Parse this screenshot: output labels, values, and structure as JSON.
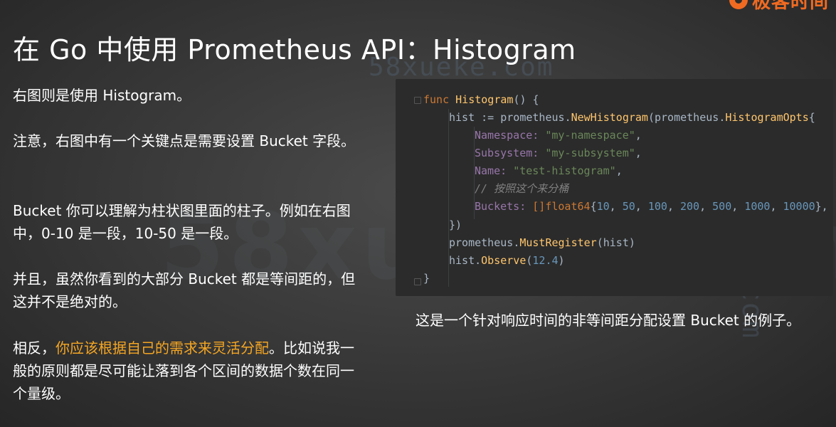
{
  "title": "在 Go 中使用 Prometheus API：Histogram",
  "brand": {
    "logo_text": "极客时间",
    "color": "#f06a21"
  },
  "watermark": {
    "text": "58xueke.com",
    "text_spaced": "58xueke.com"
  },
  "paragraphs": {
    "p1": "右图则是使用 Histogram。",
    "p2": "注意，右图中有一个关键点是需要设置 Bucket 字段。",
    "p3": "Bucket 你可以理解为柱状图里面的柱子。例如在右图中，0-10 是一段，10-50 是一段。",
    "p4": "并且，虽然你看到的大部分 Bucket 都是等间距的，但这并不是绝对的。",
    "p5_pre": "相反，",
    "p5_highlight": "你应该根据自己的需求来灵活分配",
    "p5_post": "。比如说我一般的原则都是尽可能让落到各个区间的数据个数在同一个量级。"
  },
  "highlight_color": "#f5a623",
  "code": {
    "l1_kw": "func",
    "l1_fn": "Histogram",
    "l1_rest": "() {",
    "l2_var": "hist := ",
    "l2_pkg": "prometheus",
    "l2_call": "NewHistogram",
    "l2_paren": "(",
    "l2_pkg2": "prometheus",
    "l2_type": "HistogramOpts",
    "l2_brace": "{",
    "l3_field": "Namespace: ",
    "l3_str": "\"my-namespace\"",
    "l4_field": "Subsystem: ",
    "l4_str": "\"my-subsystem\"",
    "l5_field": "Name: ",
    "l5_str": "\"test-histogram\"",
    "l6_comment": "// 按照这个来分桶",
    "l7_field": "Buckets: ",
    "l7_type": "[]float64",
    "l7_values": [
      "10",
      "50",
      "100",
      "200",
      "500",
      "1000",
      "10000"
    ],
    "l8": "})",
    "l9_pkg": "prometheus",
    "l9_call": "MustRegister",
    "l9_arg": "(hist)",
    "l10_var": "hist.",
    "l10_call": "Observe",
    "l10_num": "12.4",
    "l11": "}"
  },
  "caption": "这是一个针对响应时间的非等间距分配设置 Bucket 的例子。"
}
